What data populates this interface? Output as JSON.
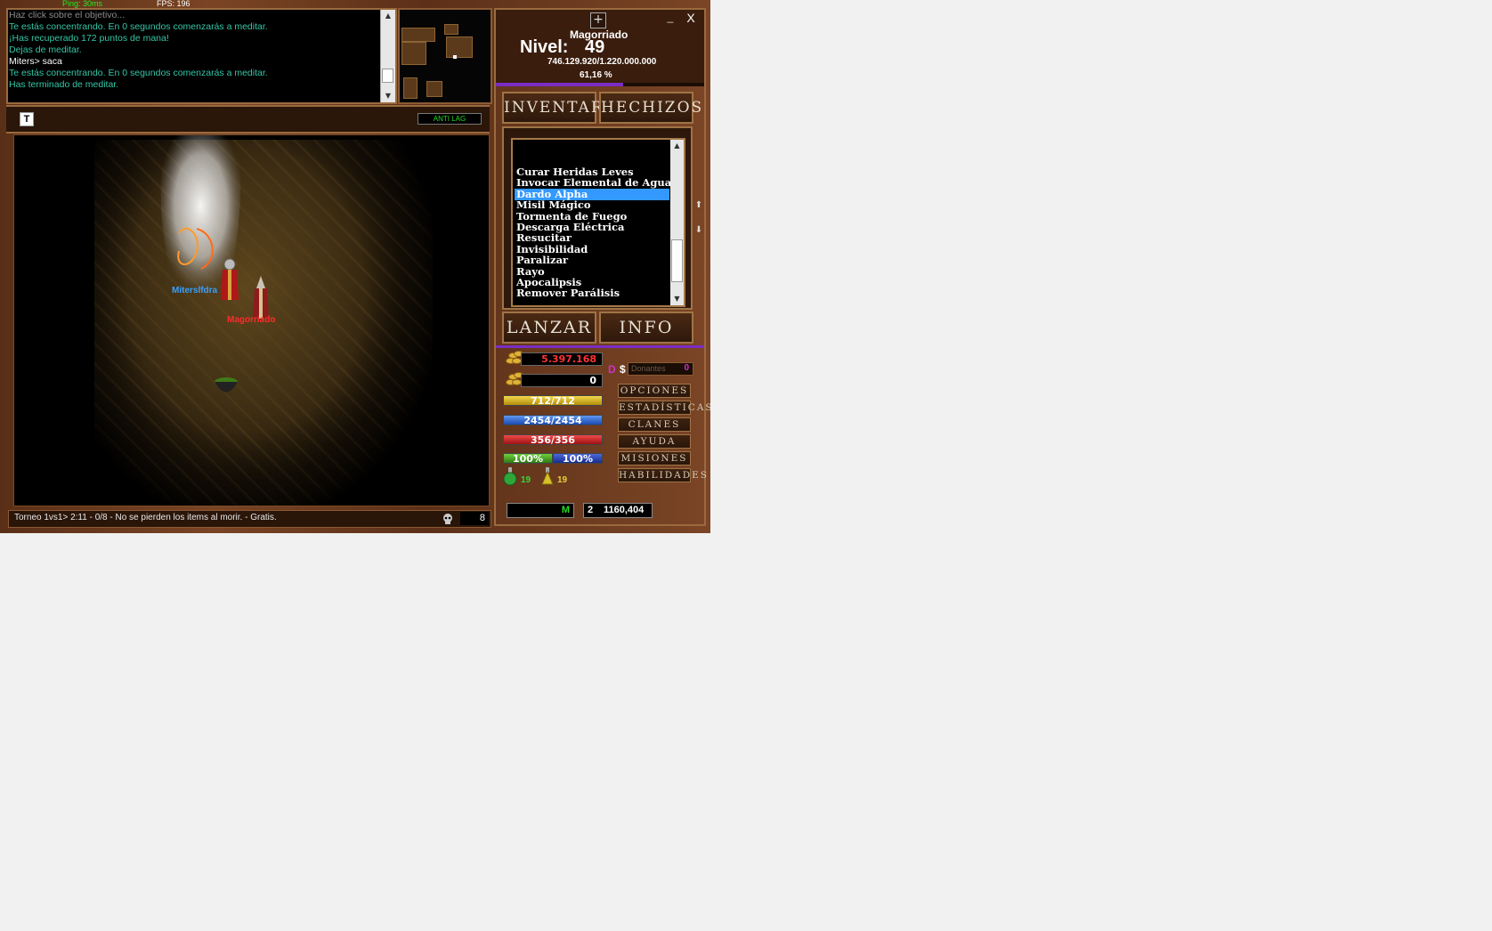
{
  "topbar": {
    "ping": "Ping: 30ms",
    "fps": "FPS: 196"
  },
  "console": {
    "lines": [
      {
        "text": "Haz click sobre el objetivo...",
        "color": "#8a8a8a"
      },
      {
        "text": "Te estás concentrando. En 0 segundos comenzarás a meditar.",
        "color": "#34c6a6"
      },
      {
        "text": "¡Has recuperado 172 puntos de mana!",
        "color": "#34c6a6"
      },
      {
        "text": "Dejas de meditar.",
        "color": "#34c6a6"
      },
      {
        "text": "Miters> saca",
        "color": "#ffffff"
      },
      {
        "text": "Te estás concentrando. En 0 segundos comenzarás a meditar.",
        "color": "#34c6a6"
      },
      {
        "text": "Has terminado de meditar.",
        "color": "#34c6a6"
      }
    ]
  },
  "toolbar": {
    "t_button": "T",
    "antilag": "ANTI LAG"
  },
  "characters": {
    "enemy": "Miterslfdra",
    "self": "Magorriado"
  },
  "statusbar": {
    "text": "Torneo 1vs1> 2:11 - 0/8 - No se pierden los items al morir. - Gratis.",
    "online": "8"
  },
  "window": {
    "minimize": "_",
    "close": "X",
    "plus": "+"
  },
  "player": {
    "name": "Magorriado",
    "level_label": "Nivel:",
    "level": "49",
    "exp": "746.129.920/1.220.000.000",
    "exp_percent": "61,16 %",
    "exp_fraction": 0.6116
  },
  "tabs": {
    "inventory": "INVENTARIO",
    "spells": "HECHIZOS"
  },
  "spells": {
    "items": [
      "Curar Heridas Leves",
      "Invocar Elemental de Agua",
      "Dardo Alpha",
      "Misil Mágico",
      "Tormenta de Fuego",
      "Descarga Eléctrica",
      "Resucitar",
      "Invisibilidad",
      "Paralizar",
      "Rayo",
      "Apocalipsis",
      "Remover Parálisis"
    ],
    "selected": "Dardo Alpha",
    "cast": "LANZAR",
    "info": "INFO"
  },
  "stats": {
    "gold": "5.397.168",
    "bank": "0",
    "stamina": "712/712",
    "mana": "2454/2454",
    "health": "356/356",
    "hunger": "100%",
    "thirst": "100%",
    "green_potions": "19",
    "yellow_potions": "19",
    "donor_d": "D",
    "donor_s": "$",
    "donor_placeholder": "Donantes",
    "donor_value": "0"
  },
  "menu": [
    "OPCIONES",
    "ESTADÍSTICAS",
    "CLANES",
    "AYUDA",
    "MISIONES",
    "HABILIDADES"
  ],
  "bottom": {
    "map_label": "M",
    "map": "2",
    "coords": "1160,404"
  },
  "colors": {
    "gold_text": "#ff3333",
    "stamina": "#e7c21e",
    "mana": "#2f6fd6",
    "health": "#d52121",
    "hunger": "#4aa52a",
    "thirst": "#2742b8",
    "exp_bar": "#7b2cc4",
    "selection": "#3399ff"
  }
}
